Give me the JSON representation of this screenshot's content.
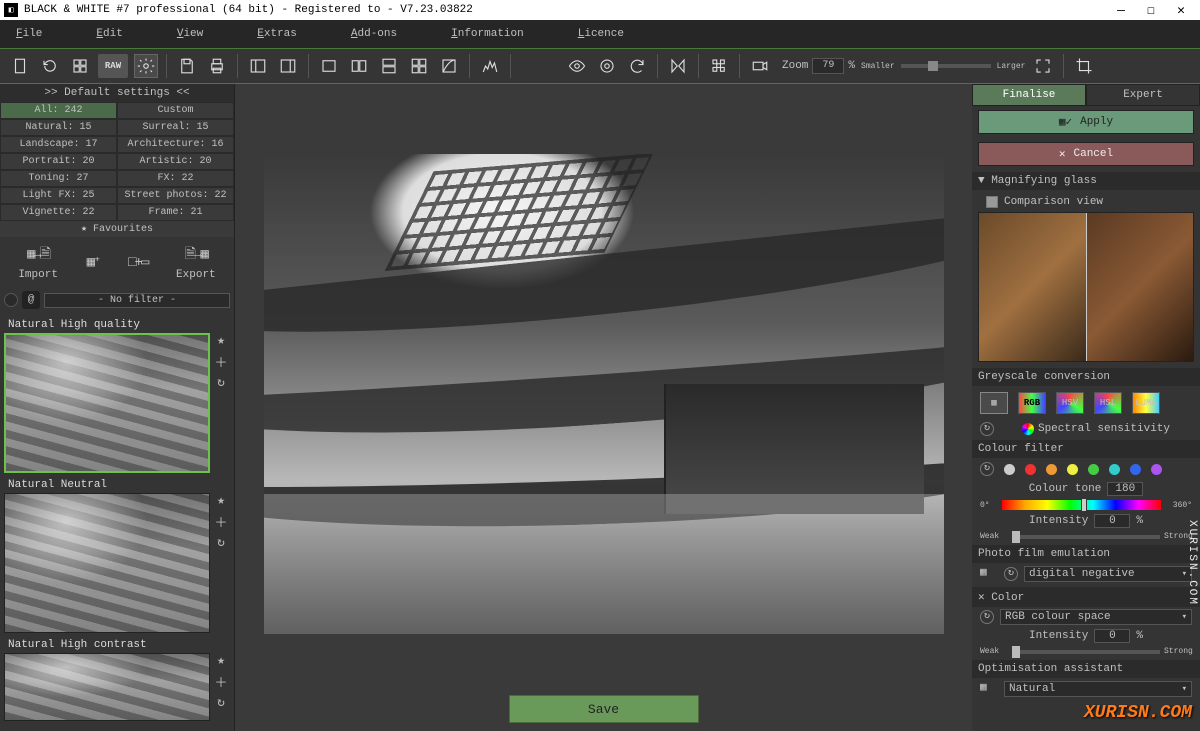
{
  "window": {
    "title": "BLACK & WHITE #7 professional (64 bit) - Registered to - V7.23.03822"
  },
  "menu": {
    "file": "File",
    "edit": "Edit",
    "view": "View",
    "extras": "Extras",
    "addons": "Add-ons",
    "information": "Information",
    "licence": "Licence"
  },
  "toolbar": {
    "zoom_label": "Zoom",
    "zoom_value": "79",
    "zoom_pct": "%",
    "smaller": "Smaller",
    "larger": "Larger"
  },
  "left": {
    "heading": ">> Default settings <<",
    "cats": {
      "all": "All: 242",
      "custom": "Custom",
      "natural": "Natural: 15",
      "surreal": "Surreal: 15",
      "landscape": "Landscape: 17",
      "architecture": "Architecture: 16",
      "portrait": "Portrait: 20",
      "artistic": "Artistic: 20",
      "toning": "Toning: 27",
      "fx": "FX: 22",
      "lightfx": "Light FX: 25",
      "street": "Street photos: 22",
      "vignette": "Vignette: 22",
      "frame": "Frame: 21"
    },
    "fav": "Favourites",
    "import": "Import",
    "export": "Export",
    "filter_sel": "- No filter -",
    "presets": {
      "p1": "Natural High quality",
      "p2": "Natural Neutral",
      "p3": "Natural High contrast"
    }
  },
  "center": {
    "save": "Save"
  },
  "right": {
    "tab_finalise": "Finalise",
    "tab_expert": "Expert",
    "apply": "Apply",
    "cancel": "Cancel",
    "mag_head": "▼ Magnifying glass",
    "mag_compare": "Comparison view",
    "grey_head": "Greyscale conversion",
    "rgb": "RGB",
    "hsv": "HSV",
    "hsl": "HSL",
    "luma": "LUMA",
    "spectral": "Spectral sensitivity",
    "colour_filter": "Colour filter",
    "colour_tone": "Colour tone",
    "colour_tone_val": "180",
    "tone_min": "0°",
    "tone_max": "360°",
    "intensity": "Intensity",
    "intensity_val": "0",
    "intensity_pct": "%",
    "weak": "Weak",
    "strong": "Strong",
    "film_head": "Photo film emulation",
    "film_sel": "digital negative",
    "color_head": "✕ Color",
    "color_space": "RGB colour space",
    "intensity2_val": "0",
    "opt_head": "Optimisation assistant",
    "opt_sel": "Natural"
  },
  "watermark": "XURISN.COM",
  "watermark_side": "XURISN.COM"
}
